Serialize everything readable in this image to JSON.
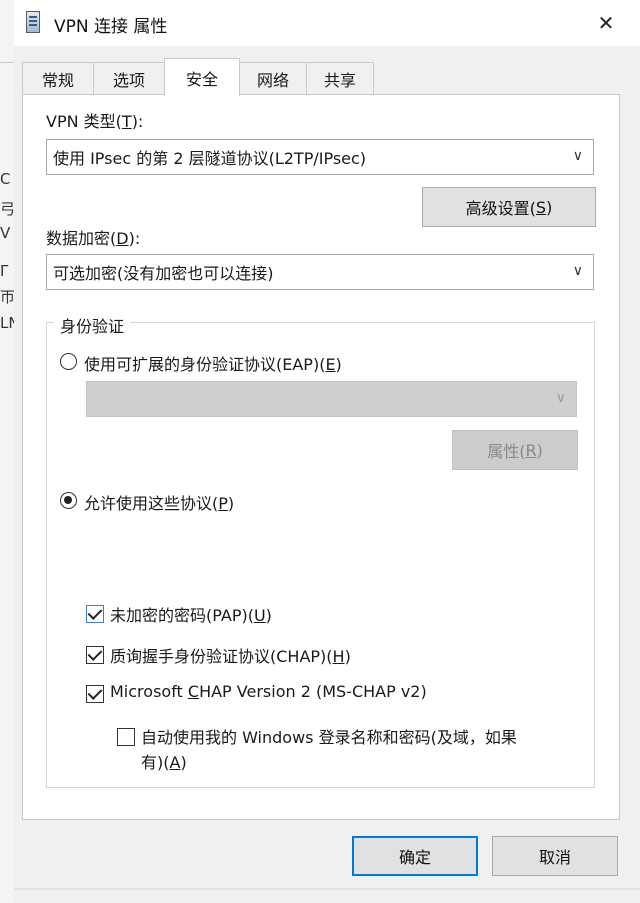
{
  "window": {
    "title": "VPN 连接 属性",
    "close_glyph": "✕"
  },
  "background_fragments": [
    "C",
    "弓",
    "V",
    "Γ",
    "帀",
    "LN"
  ],
  "tabs": [
    {
      "label": "常规"
    },
    {
      "label": "选项"
    },
    {
      "label": "安全",
      "active": true
    },
    {
      "label": "网络"
    },
    {
      "label": "共享"
    }
  ],
  "vpn_type": {
    "label_prefix": "VPN 类型(",
    "label_key": "T",
    "label_suffix": "):",
    "selected": "使用 IPsec 的第 2 层隧道协议(L2TP/IPsec)"
  },
  "advanced_button": {
    "prefix": "高级设置(",
    "key": "S",
    "suffix": ")"
  },
  "data_encryption": {
    "label_prefix": "数据加密(",
    "label_key": "D",
    "label_suffix": "):",
    "selected": "可选加密(没有加密也可以连接)"
  },
  "authentication": {
    "group_title": "身份验证",
    "eap_option": {
      "prefix": "使用可扩展的身份验证协议(EAP)(",
      "key": "E",
      "suffix": ")",
      "checked": false
    },
    "eap_combo_value": "",
    "properties_button": {
      "prefix": "属性(",
      "key": "R",
      "suffix": ")"
    },
    "allow_option": {
      "prefix": "允许使用这些协议(",
      "key": "P",
      "suffix": ")",
      "checked": true
    },
    "protocols": [
      {
        "prefix": "未加密的密码(PAP)(",
        "key": "U",
        "suffix": ")",
        "checked": true
      },
      {
        "prefix": "质询握手身份验证协议(CHAP)(",
        "key": "H",
        "suffix": ")",
        "checked": true
      },
      {
        "prefix": "Microsoft ",
        "key": "C",
        "suffix": "HAP Version 2 (MS-CHAP v2)",
        "checked": true
      }
    ],
    "auto_windows_login": {
      "line1": "自动使用我的 Windows 登录名称和密码(及域，如果",
      "line2_prefix": "有)(",
      "line2_key": "A",
      "line2_suffix": ")",
      "checked": false
    }
  },
  "ok_button": {
    "label": "确定"
  },
  "cancel_button": {
    "label": "取消"
  },
  "icons": {
    "chevron": "chevron-down-icon",
    "close": "close-icon",
    "app": "network-connection-icon"
  },
  "colors": {
    "focus_border": "#0078d7",
    "checkbox_accent": "#3c7fc6",
    "dialog_bg": "#f0f0f0"
  }
}
